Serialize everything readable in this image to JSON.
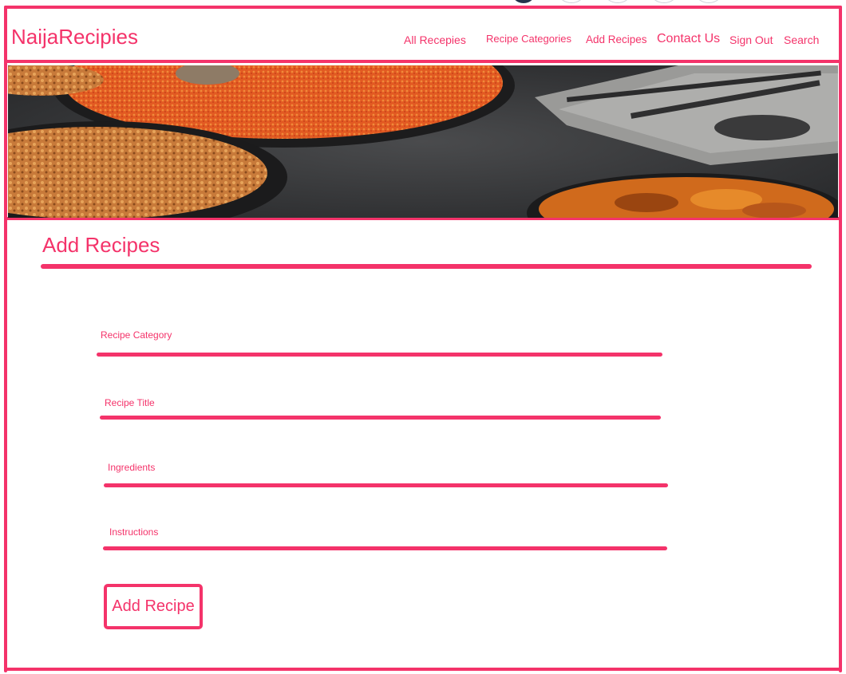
{
  "brand": {
    "name": "NaijaRecipies"
  },
  "nav": {
    "items": [
      {
        "label": "All Recepies"
      },
      {
        "label": "Recipe Categories"
      },
      {
        "label": "Add Recipes"
      },
      {
        "label": "Contact Us"
      },
      {
        "label": "Sign Out"
      },
      {
        "label": "Search"
      }
    ]
  },
  "hero": {
    "alt": "Food photo: jollof rice, fried chicken and plantain on dark plates"
  },
  "page": {
    "title": "Add Recipes"
  },
  "form": {
    "fields": [
      {
        "label": "Recipe Category",
        "value": ""
      },
      {
        "label": "Recipe Title",
        "value": ""
      },
      {
        "label": "Ingredients",
        "value": ""
      },
      {
        "label": "Instructions",
        "value": ""
      }
    ],
    "submit_label": "Add Recipe"
  },
  "colors": {
    "accent": "#f4336a",
    "background": "#ffffff"
  }
}
